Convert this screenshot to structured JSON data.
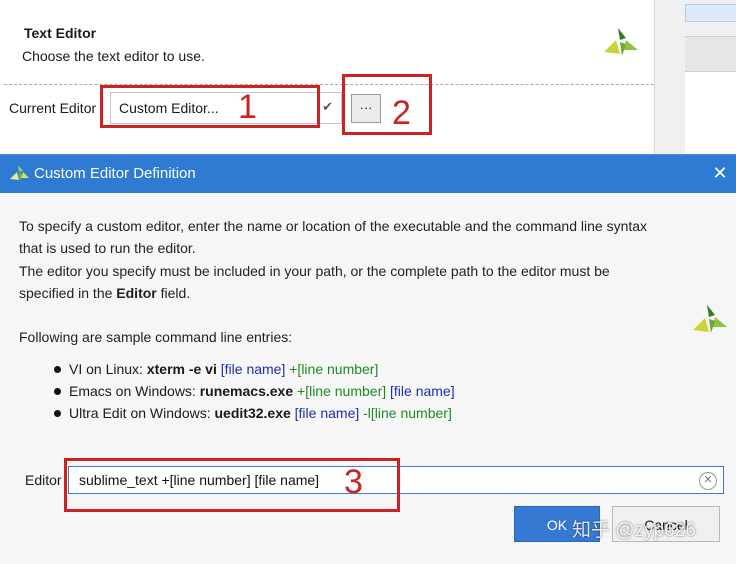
{
  "settings_panel": {
    "section_title": "Text Editor",
    "section_subtitle": "Choose the text editor to use.",
    "current_editor_label": "Current Editor",
    "current_editor_value": "Custom Editor...",
    "browse_button_label": "···",
    "logo_icon": "xilinx-logo-icon"
  },
  "dialog": {
    "title": "Custom Editor Definition",
    "close_icon": "close-icon",
    "description_line1": "To specify a custom editor, enter the name or location of the executable and the command line syntax",
    "description_line2": "that is used to run the editor.",
    "description_line3": "The editor you specify must be included in your path, or the complete path to the editor must be",
    "description_line4_pre": "specified in the ",
    "description_line4_bold": "Editor",
    "description_line4_post": " field.",
    "sample_heading": "Following are sample command line entries:",
    "samples": [
      {
        "prefix": "VI on Linux: ",
        "command": "xterm -e vi",
        "arg1": " [file name]",
        "arg2": " +[line number]"
      },
      {
        "prefix": "Emacs on Windows: ",
        "command": "runemacs.exe",
        "arg1": " +[line number]",
        "arg2": " [file name]"
      },
      {
        "prefix": "Ultra Edit on Windows: ",
        "command": "uedit32.exe",
        "arg1": " [file name]",
        "arg2": " -l[line number]"
      }
    ],
    "editor_label": "Editor",
    "editor_value": "sublime_text +[line number] [file name]",
    "ok_label": "OK",
    "cancel_label": "Cancel"
  },
  "annotations": {
    "num1": "1",
    "num2": "2",
    "num3": "3",
    "color": "#cc2222"
  },
  "watermark": "知乎 @zyp626",
  "colors": {
    "titlebar": "#2f7ad2",
    "ok_button": "#3579d3",
    "argument_blue": "#1c2fa8",
    "argument_green": "#1d8a25"
  }
}
